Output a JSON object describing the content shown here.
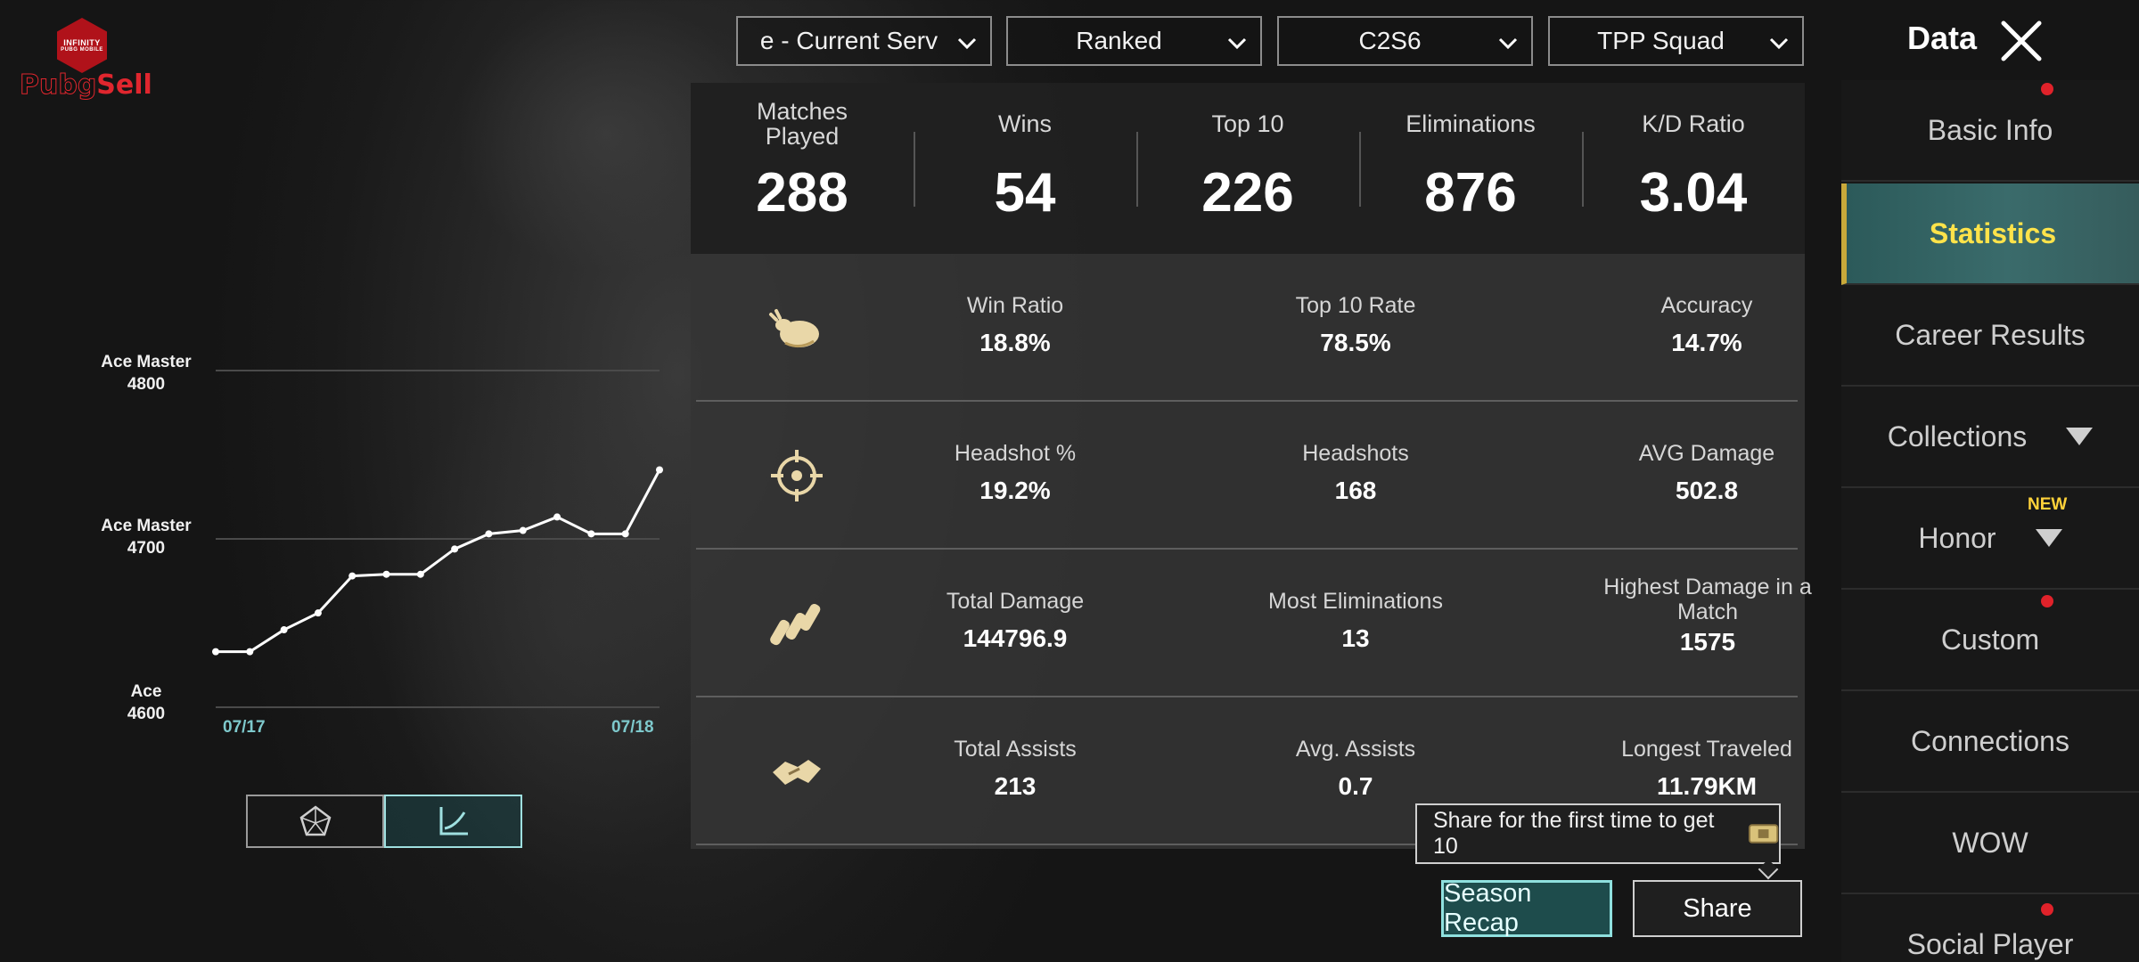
{
  "logo": {
    "top": "INFINITY",
    "sub": "PUBG MOBILE",
    "brand_a": "Pubg",
    "brand_b": "Sell"
  },
  "filters": [
    {
      "label": "e - Current Serv"
    },
    {
      "label": "Ranked"
    },
    {
      "label": "C2S6"
    },
    {
      "label": "TPP Squad"
    }
  ],
  "header": {
    "title": "Data"
  },
  "chart": {
    "tiers": [
      {
        "name": "Ace Master",
        "points": "4800"
      },
      {
        "name": "Ace Master",
        "points": "4700"
      },
      {
        "name": "Ace",
        "points": "4600"
      }
    ],
    "dates": {
      "start": "07/17",
      "end": "07/18"
    }
  },
  "chart_data": {
    "type": "line",
    "ylim": [
      4600,
      4800
    ],
    "x": [
      1,
      2,
      3,
      4,
      5,
      6,
      7,
      8,
      9,
      10,
      11,
      12,
      13,
      14
    ],
    "values": [
      4633,
      4633,
      4646,
      4656,
      4678,
      4679,
      4679,
      4694,
      4703,
      4705,
      4713,
      4703,
      4703,
      4741
    ]
  },
  "summary": [
    {
      "label": "Matches Played",
      "value": "288"
    },
    {
      "label": "Wins",
      "value": "54"
    },
    {
      "label": "Top 10",
      "value": "226"
    },
    {
      "label": "Eliminations",
      "value": "876"
    },
    {
      "label": "K/D Ratio",
      "value": "3.04"
    }
  ],
  "rows": [
    {
      "icon": "chicken-icon",
      "stats": [
        {
          "label": "Win Ratio",
          "value": "18.8%"
        },
        {
          "label": "Top 10 Rate",
          "value": "78.5%"
        },
        {
          "label": "Accuracy",
          "value": "14.7%"
        }
      ]
    },
    {
      "icon": "crosshair-icon",
      "stats": [
        {
          "label": "Headshot %",
          "value": "19.2%"
        },
        {
          "label": "Headshots",
          "value": "168"
        },
        {
          "label": "AVG Damage",
          "value": "502.8"
        }
      ]
    },
    {
      "icon": "bullets-icon",
      "stats": [
        {
          "label": "Total Damage",
          "value": "144796.9"
        },
        {
          "label": "Most Eliminations",
          "value": "13"
        },
        {
          "label": "Highest Damage in a Match",
          "value": "1575"
        }
      ]
    },
    {
      "icon": "handshake-icon",
      "stats": [
        {
          "label": "Total Assists",
          "value": "213"
        },
        {
          "label": "Avg. Assists",
          "value": "0.7"
        },
        {
          "label": "Longest Traveled",
          "value": "11.79KM"
        }
      ]
    }
  ],
  "sidebar": {
    "items": [
      {
        "label": "Basic Info"
      },
      {
        "label": "Statistics"
      },
      {
        "label": "Career Results"
      },
      {
        "label": "Collections"
      },
      {
        "label": "Honor"
      },
      {
        "label": "Custom"
      },
      {
        "label": "Connections"
      },
      {
        "label": "WOW"
      },
      {
        "label": "Social Player"
      }
    ],
    "new_tag": "NEW"
  },
  "share": {
    "tooltip": "Share for the first time to get 10",
    "recap_label": "Season Recap",
    "share_label": "Share"
  },
  "colors": {
    "accent": "#9fe0e0",
    "active_text": "#ffe34a",
    "notify": "#e0222a"
  }
}
